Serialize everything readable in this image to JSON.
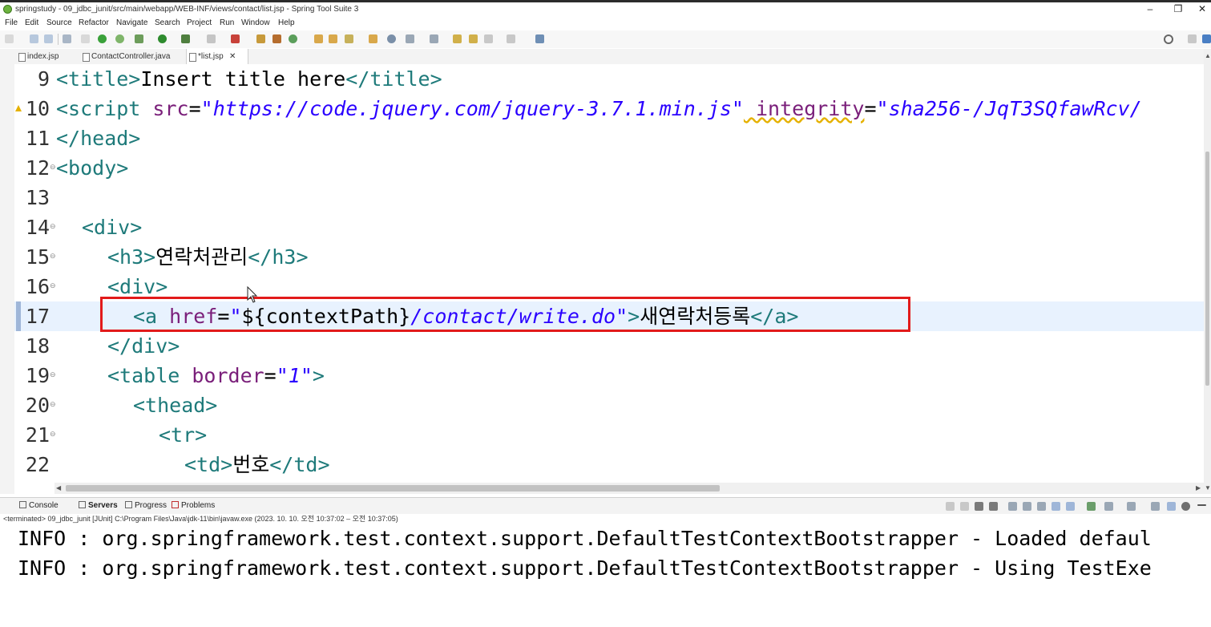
{
  "window": {
    "title": "springstudy - 09_jdbc_junit/src/main/webapp/WEB-INF/views/contact/list.jsp - Spring Tool Suite 3",
    "minimize": "–",
    "restore": "❐",
    "close": "✕"
  },
  "menu": [
    "File",
    "Edit",
    "Source",
    "Refactor",
    "Navigate",
    "Search",
    "Project",
    "Run",
    "Window",
    "Help"
  ],
  "editor_tabs": [
    {
      "label": "index.jsp",
      "active": false
    },
    {
      "label": "ContactController.java",
      "active": false
    },
    {
      "label": "*list.jsp",
      "active": true,
      "close": "✕"
    }
  ],
  "code_lines": [
    {
      "num": "9",
      "fold": ""
    },
    {
      "num": "10",
      "fold": ""
    },
    {
      "num": "11",
      "fold": ""
    },
    {
      "num": "12",
      "fold": "⊖"
    },
    {
      "num": "13",
      "fold": ""
    },
    {
      "num": "14",
      "fold": "⊖"
    },
    {
      "num": "15",
      "fold": "⊖"
    },
    {
      "num": "16",
      "fold": "⊖"
    },
    {
      "num": "17",
      "fold": ""
    },
    {
      "num": "18",
      "fold": ""
    },
    {
      "num": "19",
      "fold": "⊖"
    },
    {
      "num": "20",
      "fold": "⊖"
    },
    {
      "num": "21",
      "fold": "⊖"
    },
    {
      "num": "22",
      "fold": ""
    }
  ],
  "code": {
    "l9": {
      "t1": "<title>",
      "t2": "Insert title here",
      "t3": "</title>"
    },
    "l10": {
      "t1": "<script ",
      "a1": "src",
      "eq1": "=",
      "s1": "\"https://code.jquery.com/jquery-3.7.1.min.js\"",
      "a2": " integrity",
      "eq2": "=",
      "s2": "\"sha256-/JqT3SQfawRcv/"
    },
    "l11": {
      "t1": "</head>"
    },
    "l12": {
      "t1": "<body>"
    },
    "l14": {
      "t1": "<div>"
    },
    "l15": {
      "t1": "<h3>",
      "t2": "연락처관리",
      "t3": "</h3>"
    },
    "l16": {
      "t1": "<div>"
    },
    "l17": {
      "t1": "<a ",
      "a1": "href",
      "eq1": "=",
      "s1": "\"",
      "t2": "${contextPath}",
      "s2": "/contact/write.do\"",
      "t3": ">",
      "t4": "새연락처등록",
      "t5": "</a>"
    },
    "l18": {
      "t1": "</div>"
    },
    "l19": {
      "t1": "<table ",
      "a1": "border",
      "eq1": "=",
      "s1": "\"1\"",
      "t2": ">"
    },
    "l20": {
      "t1": "<thead>"
    },
    "l21": {
      "t1": "<tr>"
    },
    "l22": {
      "t1": "<td>",
      "t2": "번호",
      "t3": "</td>"
    }
  },
  "console": {
    "tabs": [
      {
        "label": "Console",
        "bold": false
      },
      {
        "label": "Servers",
        "bold": true
      },
      {
        "label": "Progress",
        "bold": false
      },
      {
        "label": "Problems",
        "bold": false
      }
    ],
    "status": "<terminated> 09_jdbc_junit [JUnit] C:\\Program Files\\Java\\jdk-11\\bin\\javaw.exe  (2023. 10. 10. 오전 10:37:02 – 오전 10:37:05)",
    "lines": [
      "INFO : org.springframework.test.context.support.DefaultTestContextBootstrapper - Loaded defaul",
      "INFO : org.springframework.test.context.support.DefaultTestContextBootstrapper - Using TestExe"
    ]
  }
}
